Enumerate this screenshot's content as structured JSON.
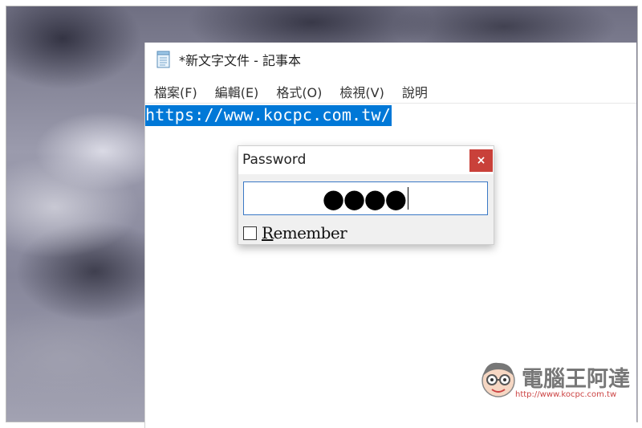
{
  "notepad": {
    "title": "*新文字文件 - 記事本",
    "menu": [
      "檔案(F)",
      "編輯(E)",
      "格式(O)",
      "檢視(V)",
      "說明"
    ],
    "content": "https://www.kocpc.com.tw/"
  },
  "dialog": {
    "title": "Password",
    "close_label": "×",
    "password_value": "●●●●",
    "remember_label_first": "R",
    "remember_label_rest": "emember",
    "remember_checked": false
  },
  "watermark": {
    "brand": "電腦王阿達",
    "url": "http://www.kocpc.com.tw"
  },
  "icons": {
    "app": "notepad-icon",
    "close": "close-icon",
    "mascot": "mascot-icon"
  },
  "colors": {
    "selection": "#0078d7",
    "close_button": "#c9413a",
    "field_border": "#3a78c5"
  }
}
